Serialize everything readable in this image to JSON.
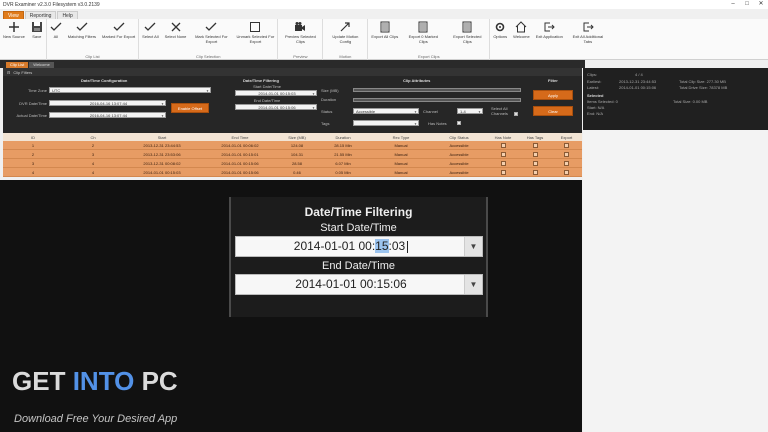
{
  "window": {
    "title": "DVR Examiner v2.3.0 Filesystem v3.0.2139",
    "controls": [
      "–",
      "□",
      "✕"
    ]
  },
  "menu_tabs": [
    {
      "label": "View",
      "active": true
    },
    {
      "label": "Reporting",
      "active": false
    },
    {
      "label": "Help",
      "active": false
    }
  ],
  "ribbon": {
    "groups": [
      {
        "label": "",
        "buttons": [
          {
            "label": "New Source",
            "icon": "plus-icon"
          },
          {
            "label": "Save",
            "icon": "save-icon"
          }
        ]
      },
      {
        "label": "Clip List",
        "buttons": [
          {
            "label": "All",
            "icon": "check-all-icon"
          },
          {
            "label": "Matching Filters",
            "icon": "check-filter-icon"
          },
          {
            "label": "Marked For Export",
            "icon": "check-export-icon"
          }
        ]
      },
      {
        "label": "Clip Selection",
        "buttons": [
          {
            "label": "Select All",
            "icon": "select-all-icon"
          },
          {
            "label": "Select None",
            "icon": "select-none-icon"
          },
          {
            "label": "Mark Selected For Export",
            "icon": "mark-export-icon"
          },
          {
            "label": "Unmark Selected For Export",
            "icon": "unmark-export-icon"
          }
        ]
      },
      {
        "label": "Preview",
        "buttons": [
          {
            "label": "Preview Selected Clips",
            "icon": "video-camera-icon"
          }
        ]
      },
      {
        "label": "Motion",
        "buttons": [
          {
            "label": "Update Motion Config",
            "icon": "motion-config-icon"
          }
        ]
      },
      {
        "label": "Export Clips",
        "buttons": [
          {
            "label": "Export All Clips",
            "icon": "export-all-icon"
          },
          {
            "label": "Export 0 Marked Clips",
            "icon": "export-marked-icon"
          },
          {
            "label": "Export Selected Clips",
            "icon": "export-selected-icon"
          }
        ]
      },
      {
        "label": "",
        "buttons": [
          {
            "label": "Options",
            "icon": "gear-icon"
          },
          {
            "label": "Welcome",
            "icon": "home-icon"
          },
          {
            "label": "Exit Application",
            "icon": "exit-icon"
          },
          {
            "label": "Exit All Additional Tabs",
            "icon": "exit-tabs-icon"
          }
        ]
      }
    ]
  },
  "doc_tabs": [
    {
      "label": "Clip List",
      "active": true
    },
    {
      "label": "Welcome",
      "active": false
    }
  ],
  "filters_panel": {
    "header": "Clip Filters",
    "datetime_config": {
      "title": "Date/Time Configuration",
      "timezone_label": "Time Zone",
      "timezone_value": "UTC",
      "dvr_label": "DVR Date/Time",
      "dvr_value": "2016-04-16 13:07:44",
      "actual_label": "Actual Date/Time",
      "actual_value": "2016-04-16 13:07:44",
      "offset_button": "Enable Offset"
    },
    "datetime_filtering": {
      "title": "Date/Time Filtering",
      "start_label": "Start Date/Time",
      "start_value": "2014-01-01 00:15:03",
      "end_label": "End Date/Time",
      "end_value": "2014-01-01 00:15:06"
    },
    "clip_attributes": {
      "title": "Clip Attributes",
      "size_label": "Size (MB)",
      "duration_label": "Duration",
      "status_label": "Status",
      "status_value": "Accessible",
      "channel_label": "Channel",
      "channel_value": "1-4",
      "select_all_channels": "Select All Channels",
      "tags_label": "Tags",
      "has_notes_label": "Has Notes"
    },
    "filter": {
      "title": "Filter",
      "apply_label": "Apply",
      "clear_label": "Clear"
    }
  },
  "table": {
    "columns": [
      "ID",
      "Ch",
      "Start",
      "End Time",
      "Size (MB)",
      "Duration",
      "Rec Type",
      "Clip Status",
      "Has Note",
      "Has Tags",
      "Export"
    ],
    "rows": [
      [
        "1",
        "2",
        "2013-12-31 23:44:53",
        "2014-01-01 00:06:02",
        "124.08",
        "28.15 Min",
        "Manual",
        "Accessible"
      ],
      [
        "2",
        "3",
        "2013-12-31 23:53:06",
        "2014-01-01 00:15:01",
        "104.31",
        "21.55 Min",
        "Manual",
        "Accessible"
      ],
      [
        "3",
        "4",
        "2013-12-31 00:08:02",
        "2014-01-01 00:15:06",
        "28.58",
        "6.07 Min",
        "Manual",
        "Accessible"
      ],
      [
        "4",
        "4",
        "2014-01-01 00:15:03",
        "2014-01-01 00:15:06",
        "0.46",
        "0.05 Min",
        "Manual",
        "Accessible"
      ]
    ]
  },
  "info_panel": {
    "clips_label": "Clips:",
    "clips_value": "4 / 4",
    "earliest_label": "Earliest:",
    "earliest_value": "2013-12-31 23:44:53",
    "latest_label": "Latest:",
    "latest_value": "2014-01-01 00:15:06",
    "total_clip_size": "Total Clip Size: 277.30 MB",
    "total_drive_size": "Total Drive Size: 78378 MB",
    "selected_title": "Selected",
    "items_selected": "Items Selected: 0",
    "total_size": "Total Size: 0.00 MB",
    "start": "Start: N/A",
    "end": "End: N/A"
  },
  "zoom": {
    "title": "Date/Time Filtering",
    "start_label": "Start Date/Time",
    "start_prefix": "2014-01-01 00:",
    "start_highlight": "15",
    "start_suffix": ":03",
    "end_label": "End Date/Time",
    "end_value": "2014-01-01 00:15:06"
  },
  "watermark": {
    "get": "GET",
    "into": "INTO",
    "pc": "PC",
    "subtitle": "Download Free Your Desired App"
  }
}
